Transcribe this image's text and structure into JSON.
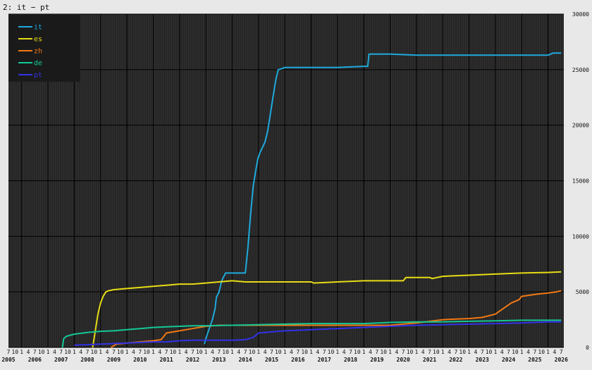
{
  "window": {
    "title": "2: it − pt"
  },
  "colors": {
    "page_bg": "#e8e8e8",
    "plot_bg": "#262626",
    "hatch": "#3a3a3a",
    "major_grid": "#000000",
    "legend_bg": "#1a1a1a"
  },
  "chart_data": {
    "type": "line",
    "title": "2: it − pt",
    "xlabel": "",
    "ylabel": "",
    "xlim": [
      2005.5,
      2026.6
    ],
    "ylim": [
      0,
      30000
    ],
    "yticks": [
      0,
      5000,
      10000,
      15000,
      20000,
      25000,
      30000
    ],
    "years": [
      "2005",
      "2006",
      "2007",
      "2008",
      "2009",
      "2010",
      "2011",
      "2012",
      "2013",
      "2014",
      "2015",
      "2016",
      "2017",
      "2018",
      "2019",
      "2020",
      "2021",
      "2022",
      "2023",
      "2024",
      "2025",
      "2026"
    ],
    "quarter_labels": [
      "1",
      "4",
      "7",
      "10"
    ],
    "grid": true,
    "legend_position": "top-left",
    "series": [
      {
        "name": "it",
        "color": "#1eaadc",
        "x": [
          2012.95,
          2013.0,
          2013.1,
          2013.25,
          2013.35,
          2013.4,
          2013.5,
          2013.6,
          2013.75,
          2013.85,
          2014.0,
          2014.5,
          2014.6,
          2014.7,
          2014.8,
          2014.9,
          2014.98,
          2015.05,
          2015.15,
          2015.25,
          2015.35,
          2015.45,
          2015.55,
          2015.65,
          2015.75,
          2015.9,
          2016.0,
          2016.1,
          2016.2,
          2016.5,
          2017.0,
          2018.0,
          2019.0,
          2019.15,
          2019.2,
          2020.0,
          2021.0,
          2022.0,
          2023.0,
          2024.0,
          2025.0,
          2026.0,
          2026.2,
          2026.5
        ],
        "values": [
          300,
          800,
          1500,
          2500,
          3500,
          4500,
          5000,
          6000,
          6700,
          6700,
          6700,
          6700,
          9000,
          12000,
          14500,
          16000,
          17000,
          17500,
          18000,
          18500,
          19500,
          21000,
          22500,
          24000,
          25000,
          25100,
          25200,
          25200,
          25200,
          25200,
          25200,
          25200,
          25300,
          25300,
          26400,
          26400,
          26300,
          26300,
          26300,
          26300,
          26300,
          26300,
          26500,
          26500
        ]
      },
      {
        "name": "es",
        "color": "#e6dc14",
        "x": [
          2008.7,
          2008.8,
          2008.9,
          2009.0,
          2009.1,
          2009.2,
          2009.3,
          2009.5,
          2010.0,
          2010.5,
          2011.0,
          2011.5,
          2012.0,
          2012.5,
          2013.0,
          2013.5,
          2014.0,
          2014.5,
          2015.0,
          2016.0,
          2017.0,
          2017.1,
          2018.0,
          2019.0,
          2019.5,
          2020.0,
          2020.5,
          2020.6,
          2021.0,
          2021.5,
          2021.6,
          2022.0,
          2023.0,
          2024.0,
          2025.0,
          2026.0,
          2026.5
        ],
        "values": [
          0,
          1500,
          3000,
          4000,
          4600,
          5000,
          5100,
          5200,
          5300,
          5400,
          5500,
          5600,
          5700,
          5700,
          5800,
          5900,
          6000,
          5900,
          5900,
          5900,
          5900,
          5800,
          5900,
          6000,
          6000,
          6000,
          6000,
          6300,
          6300,
          6300,
          6200,
          6400,
          6500,
          6600,
          6700,
          6750,
          6800
        ]
      },
      {
        "name": "zh",
        "color": "#f07814",
        "x": [
          2009.4,
          2009.6,
          2010.0,
          2010.5,
          2011.0,
          2011.3,
          2011.5,
          2012.0,
          2012.5,
          2013.0,
          2013.5,
          2014.0,
          2014.5,
          2015.0,
          2016.0,
          2017.0,
          2018.0,
          2019.0,
          2020.0,
          2021.0,
          2022.0,
          2023.0,
          2023.5,
          2024.0,
          2024.3,
          2024.6,
          2024.9,
          2025.0,
          2025.3,
          2025.6,
          2026.0,
          2026.3,
          2026.5
        ],
        "values": [
          0,
          300,
          400,
          500,
          600,
          700,
          1300,
          1500,
          1700,
          1900,
          2000,
          2000,
          2000,
          2000,
          2000,
          2000,
          2000,
          2000,
          2000,
          2200,
          2500,
          2600,
          2700,
          3000,
          3500,
          4000,
          4300,
          4600,
          4700,
          4800,
          4900,
          5000,
          5100
        ]
      },
      {
        "name": "de",
        "color": "#14c896",
        "x": [
          2007.55,
          2007.6,
          2007.7,
          2008.0,
          2008.5,
          2009.0,
          2009.5,
          2010.0,
          2010.5,
          2011.0,
          2011.5,
          2012.0,
          2012.5,
          2013.0,
          2014.0,
          2015.0,
          2016.0,
          2017.0,
          2018.0,
          2019.0,
          2020.0,
          2021.0,
          2022.0,
          2023.0,
          2024.0,
          2025.0,
          2026.0,
          2026.5
        ],
        "values": [
          0,
          800,
          1000,
          1200,
          1350,
          1450,
          1500,
          1600,
          1700,
          1800,
          1850,
          1900,
          1950,
          1950,
          2000,
          2050,
          2100,
          2150,
          2150,
          2150,
          2250,
          2300,
          2300,
          2350,
          2400,
          2450,
          2450,
          2450
        ]
      },
      {
        "name": "pt",
        "color": "#3232e6",
        "x": [
          2008.0,
          2008.5,
          2009.0,
          2009.5,
          2010.0,
          2010.5,
          2011.0,
          2011.5,
          2012.0,
          2012.5,
          2013.0,
          2013.5,
          2014.0,
          2014.5,
          2014.8,
          2014.9,
          2015.0,
          2015.5,
          2016.0,
          2016.5,
          2017.0,
          2017.5,
          2018.0,
          2018.5,
          2019.0,
          2019.5,
          2020.0,
          2020.5,
          2021.0,
          2022.0,
          2023.0,
          2024.0,
          2025.0,
          2025.5,
          2026.0,
          2026.5
        ],
        "values": [
          200,
          250,
          300,
          350,
          400,
          450,
          500,
          500,
          600,
          650,
          650,
          650,
          650,
          700,
          900,
          1100,
          1300,
          1400,
          1500,
          1550,
          1600,
          1650,
          1700,
          1750,
          1800,
          1850,
          1900,
          1950,
          2000,
          2050,
          2100,
          2150,
          2200,
          2250,
          2300,
          2300
        ]
      }
    ]
  }
}
